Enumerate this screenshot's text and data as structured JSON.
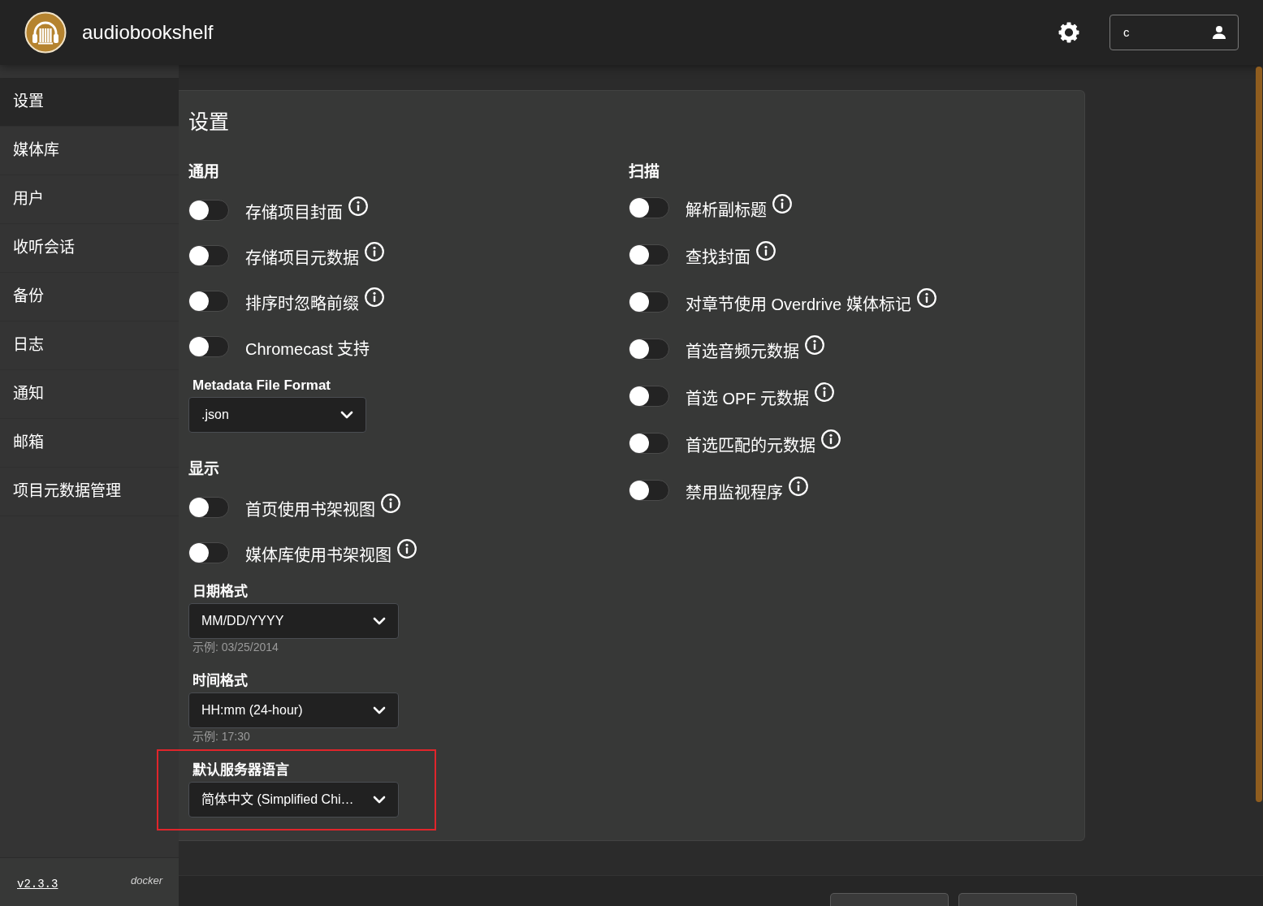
{
  "header": {
    "app_name": "audiobookshelf",
    "user": {
      "name": "c"
    }
  },
  "sidebar": {
    "items": [
      {
        "label": "设置",
        "selected": true
      },
      {
        "label": "媒体库",
        "selected": false
      },
      {
        "label": "用户",
        "selected": false
      },
      {
        "label": "收听会话",
        "selected": false
      },
      {
        "label": "备份",
        "selected": false
      },
      {
        "label": "日志",
        "selected": false
      },
      {
        "label": "通知",
        "selected": false
      },
      {
        "label": "邮箱",
        "selected": false
      },
      {
        "label": "项目元数据管理",
        "selected": false
      }
    ],
    "version": "v2.3.3",
    "install_type": "docker"
  },
  "settings": {
    "title": "设置",
    "columns": [
      {
        "sections": [
          {
            "heading": "通用",
            "items": [
              {
                "kind": "toggle",
                "label": "存储项目封面",
                "on": false,
                "info": true
              },
              {
                "kind": "toggle",
                "label": "存储项目元数据",
                "on": false,
                "info": true
              },
              {
                "kind": "toggle",
                "label": "排序时忽略前缀",
                "on": false,
                "info": true
              },
              {
                "kind": "toggle",
                "label": "Chromecast 支持",
                "on": false,
                "info": false
              },
              {
                "kind": "select",
                "label": "Metadata File Format",
                "value": ".json",
                "highlighted": false
              }
            ]
          },
          {
            "heading": "显示",
            "items": [
              {
                "kind": "toggle",
                "label": "首页使用书架视图",
                "on": false,
                "info": true
              },
              {
                "kind": "toggle",
                "label": "媒体库使用书架视图",
                "on": false,
                "info": true
              },
              {
                "kind": "select",
                "label": "日期格式",
                "value": "MM/DD/YYYY",
                "hint": "示例: 03/25/2014",
                "highlighted": false
              },
              {
                "kind": "select",
                "label": "时间格式",
                "value": "HH:mm (24-hour)",
                "hint": "示例: 17:30",
                "highlighted": false
              },
              {
                "kind": "select",
                "label": "默认服务器语言",
                "value": "简体中文 (Simplified Chi…",
                "highlighted": true
              }
            ]
          }
        ]
      },
      {
        "sections": [
          {
            "heading": "扫描",
            "items": [
              {
                "kind": "toggle",
                "label": "解析副标题",
                "on": false,
                "info": true
              },
              {
                "kind": "toggle",
                "label": "查找封面",
                "on": false,
                "info": true
              },
              {
                "kind": "toggle",
                "label": "对章节使用 Overdrive 媒体标记",
                "on": false,
                "info": true
              },
              {
                "kind": "toggle",
                "label": "首选音频元数据",
                "on": false,
                "info": true
              },
              {
                "kind": "toggle",
                "label": "首选 OPF 元数据",
                "on": false,
                "info": true
              },
              {
                "kind": "toggle",
                "label": "首选匹配的元数据",
                "on": false,
                "info": true
              },
              {
                "kind": "toggle",
                "label": "禁用监视程序",
                "on": false,
                "info": true
              }
            ]
          }
        ]
      }
    ]
  }
}
